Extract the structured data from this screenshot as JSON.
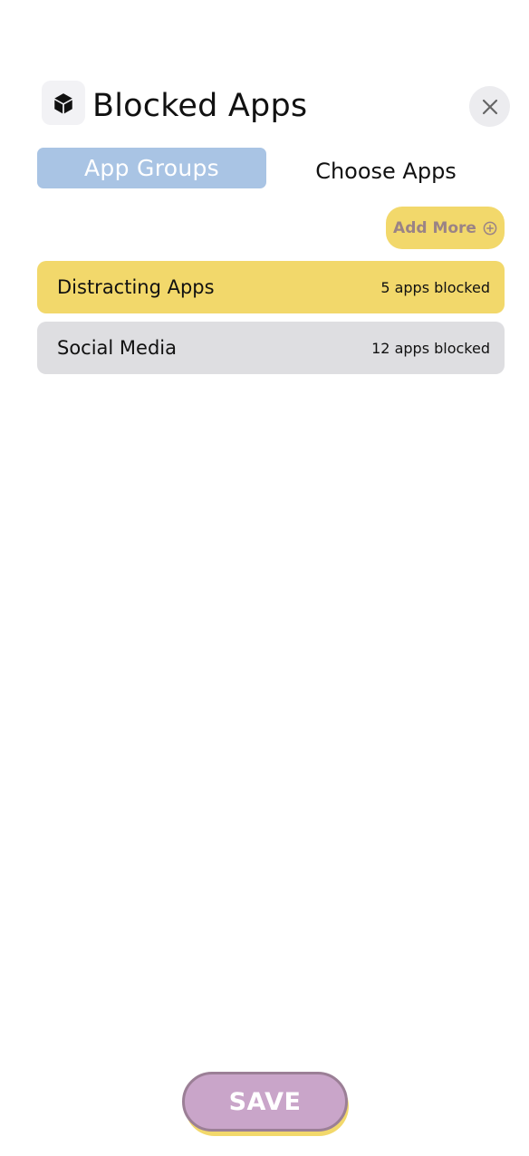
{
  "header": {
    "app_icon": "cube-icon",
    "title": "Blocked Apps",
    "close_icon": "close-icon"
  },
  "tabs": [
    {
      "label": "App Groups",
      "active": true
    },
    {
      "label": "Choose Apps",
      "active": false
    }
  ],
  "add_more": {
    "label": "Add More",
    "icon": "plus-circle-icon"
  },
  "groups": [
    {
      "name": "Distracting Apps",
      "count_label": "5 apps blocked",
      "color": "#f2d86b"
    },
    {
      "name": "Social Media",
      "count_label": "12 apps blocked",
      "color": "#dedee1"
    }
  ],
  "footer": {
    "save_label": "SAVE"
  },
  "colors": {
    "tab_active": "#a9c4e4",
    "accent_yellow": "#f2d86b",
    "save_button": "#c9a5c9",
    "save_border": "#9b7f96"
  }
}
